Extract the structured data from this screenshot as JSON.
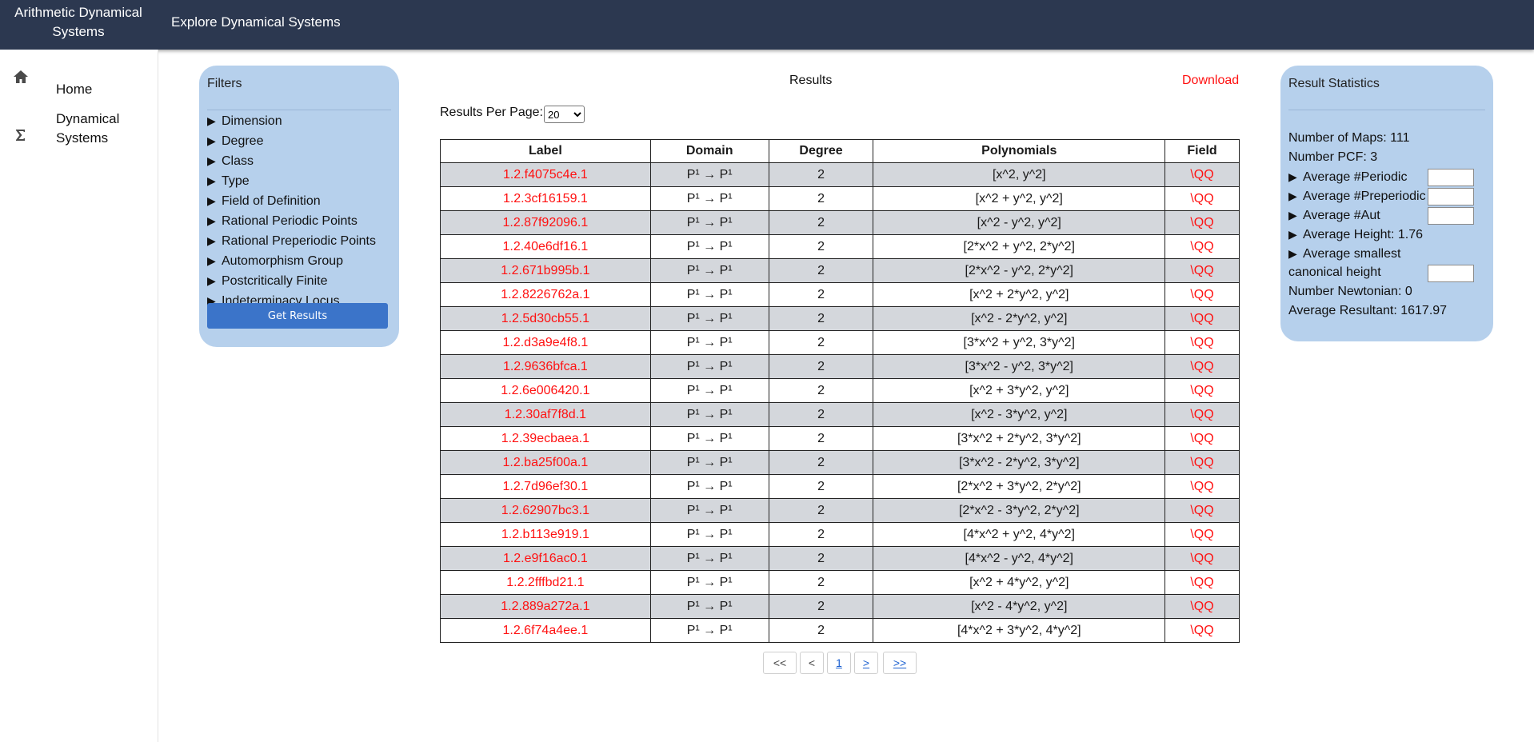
{
  "header": {
    "brand_line1": "Arithmetic Dynamical",
    "brand_line2": "Systems",
    "nav_label": "Explore Dynamical Systems"
  },
  "sidebar": {
    "items": [
      {
        "label": "Home",
        "icon": "home-icon"
      },
      {
        "label_line1": "Dynamical",
        "label_line2": "Systems",
        "icon": "sigma-icon"
      }
    ]
  },
  "filters": {
    "title": "Filters",
    "items": [
      "Dimension",
      "Degree",
      "Class",
      "Type",
      "Field of Definition",
      "Rational Periodic Points",
      "Rational Preperiodic Points",
      "Automorphism Group",
      "Postcritically Finite",
      "Indeterminacy Locus"
    ],
    "button_label": "Get Results"
  },
  "results": {
    "title": "Results",
    "download_label": "Download",
    "per_page_label": "Results Per Page:",
    "per_page_value": "20",
    "columns": [
      "Label",
      "Domain",
      "Degree",
      "Polynomials",
      "Field"
    ],
    "domain_text": "P¹ → P¹",
    "rows": [
      {
        "label": "1.2.f4075c4e.1",
        "degree": "2",
        "poly": "[x^2, y^2]",
        "field": "\\QQ"
      },
      {
        "label": "1.2.3cf16159.1",
        "degree": "2",
        "poly": "[x^2 + y^2, y^2]",
        "field": "\\QQ"
      },
      {
        "label": "1.2.87f92096.1",
        "degree": "2",
        "poly": "[x^2 - y^2, y^2]",
        "field": "\\QQ"
      },
      {
        "label": "1.2.40e6df16.1",
        "degree": "2",
        "poly": "[2*x^2 + y^2, 2*y^2]",
        "field": "\\QQ"
      },
      {
        "label": "1.2.671b995b.1",
        "degree": "2",
        "poly": "[2*x^2 - y^2, 2*y^2]",
        "field": "\\QQ"
      },
      {
        "label": "1.2.8226762a.1",
        "degree": "2",
        "poly": "[x^2 + 2*y^2, y^2]",
        "field": "\\QQ"
      },
      {
        "label": "1.2.5d30cb55.1",
        "degree": "2",
        "poly": "[x^2 - 2*y^2, y^2]",
        "field": "\\QQ"
      },
      {
        "label": "1.2.d3a9e4f8.1",
        "degree": "2",
        "poly": "[3*x^2 + y^2, 3*y^2]",
        "field": "\\QQ"
      },
      {
        "label": "1.2.9636bfca.1",
        "degree": "2",
        "poly": "[3*x^2 - y^2, 3*y^2]",
        "field": "\\QQ"
      },
      {
        "label": "1.2.6e006420.1",
        "degree": "2",
        "poly": "[x^2 + 3*y^2, y^2]",
        "field": "\\QQ"
      },
      {
        "label": "1.2.30af7f8d.1",
        "degree": "2",
        "poly": "[x^2 - 3*y^2, y^2]",
        "field": "\\QQ"
      },
      {
        "label": "1.2.39ecbaea.1",
        "degree": "2",
        "poly": "[3*x^2 + 2*y^2, 3*y^2]",
        "field": "\\QQ"
      },
      {
        "label": "1.2.ba25f00a.1",
        "degree": "2",
        "poly": "[3*x^2 - 2*y^2, 3*y^2]",
        "field": "\\QQ"
      },
      {
        "label": "1.2.7d96ef30.1",
        "degree": "2",
        "poly": "[2*x^2 + 3*y^2, 2*y^2]",
        "field": "\\QQ"
      },
      {
        "label": "1.2.62907bc3.1",
        "degree": "2",
        "poly": "[2*x^2 - 3*y^2, 2*y^2]",
        "field": "\\QQ"
      },
      {
        "label": "1.2.b113e919.1",
        "degree": "2",
        "poly": "[4*x^2 + y^2, 4*y^2]",
        "field": "\\QQ"
      },
      {
        "label": "1.2.e9f16ac0.1",
        "degree": "2",
        "poly": "[4*x^2 - y^2, 4*y^2]",
        "field": "\\QQ"
      },
      {
        "label": "1.2.2fffbd21.1",
        "degree": "2",
        "poly": "[x^2 + 4*y^2, y^2]",
        "field": "\\QQ"
      },
      {
        "label": "1.2.889a272a.1",
        "degree": "2",
        "poly": "[x^2 - 4*y^2, y^2]",
        "field": "\\QQ"
      },
      {
        "label": "1.2.6f74a4ee.1",
        "degree": "2",
        "poly": "[4*x^2 + 3*y^2, 4*y^2]",
        "field": "\\QQ"
      }
    ]
  },
  "pagination": {
    "first": "<<",
    "prev": "<",
    "current": "1",
    "next": ">",
    "last": ">>"
  },
  "stats": {
    "title": "Result Statistics",
    "num_maps": "Number of Maps: 111",
    "num_pcf": "Number PCF: 3",
    "avg_periodic": "Average #Periodic",
    "avg_preperiodic": "Average #Preperiodic",
    "avg_aut": "Average #Aut",
    "avg_height": "Average Height: 1.76",
    "avg_smallest_line1": "Average smallest",
    "avg_smallest_line2": "canonical height",
    "num_newtonian": "Number Newtonian: 0",
    "avg_resultant": "Average Resultant: 1617.97"
  },
  "colors": {
    "topbar": "#2c3850",
    "panel": "#b6d0ec",
    "link_red": "#ff1111",
    "button_blue": "#3b74c9",
    "row_stripe": "#d4d7dc"
  }
}
